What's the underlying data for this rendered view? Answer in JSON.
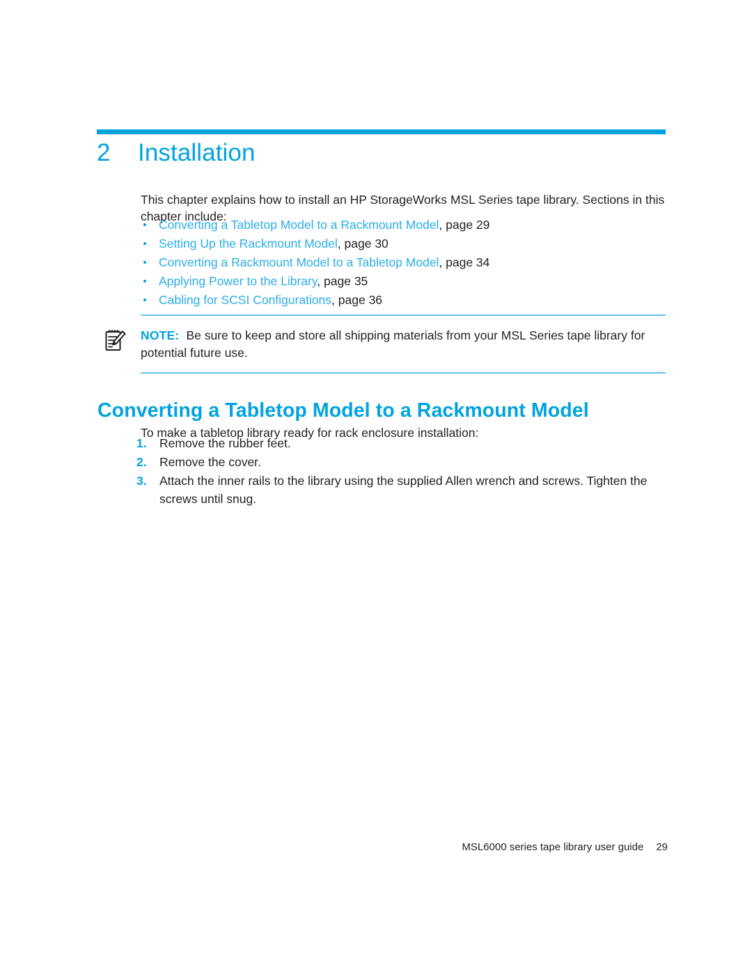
{
  "colors": {
    "accent": "#00a3dd",
    "link": "#2aaee6",
    "rule_light": "#62c8ea",
    "text": "#231f20"
  },
  "chapter": {
    "number": "2",
    "title": "Installation"
  },
  "intro": "This chapter explains how to install an HP StorageWorks MSL Series tape library. Sections in this chapter include:",
  "toc": [
    {
      "link": "Converting a Tabletop Model to a Rackmount Model",
      "ref": ", page 29"
    },
    {
      "link": "Setting Up the Rackmount Model",
      "ref": ", page 30"
    },
    {
      "link": "Converting a Rackmount Model to a Tabletop Model",
      "ref": ", page 34"
    },
    {
      "link": "Applying Power to the Library",
      "ref": ", page 35"
    },
    {
      "link": "Cabling for SCSI Configurations",
      "ref": ", page 36"
    }
  ],
  "note": {
    "icon": "note-pad-pencil-icon",
    "label": "NOTE:",
    "text": "Be sure to keep and store all shipping materials from your MSL Series tape library for potential future use."
  },
  "section": {
    "heading": "Converting a Tabletop Model to a Rackmount Model",
    "intro": "To make a tabletop library ready for rack enclosure installation:",
    "steps": [
      {
        "num": "1.",
        "text": "Remove the rubber feet."
      },
      {
        "num": "2.",
        "text": "Remove the cover."
      },
      {
        "num": "3.",
        "text": "Attach the inner rails to the library using the supplied Allen wrench and screws. Tighten the screws until snug."
      }
    ]
  },
  "footer": {
    "guide": "MSL6000 series tape library user guide",
    "page": "29"
  }
}
